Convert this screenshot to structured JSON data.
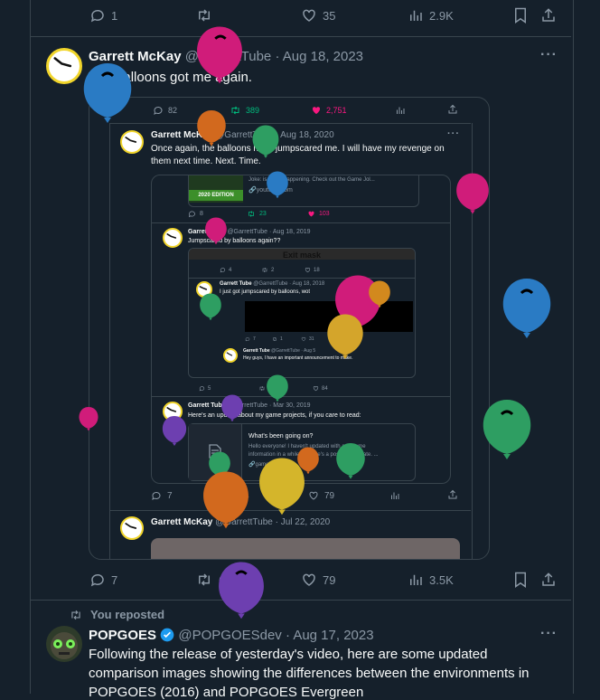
{
  "top_actions": {
    "replies": "1",
    "retweets": "",
    "likes": "35",
    "views": "2.9K"
  },
  "tweet1": {
    "name": "Garrett McKay",
    "handle": "@GarrettTube",
    "date": "· Aug 18, 2023",
    "text": "The balloons got me again.",
    "more": "···",
    "actions": {
      "replies": "7",
      "retweets": "6",
      "likes": "79",
      "views": "3.5K"
    }
  },
  "embed1": {
    "actions": {
      "replies": "82",
      "retweets": "389",
      "likes": "2,751"
    },
    "name": "Garrett McKay",
    "handle": "@GarrettTube",
    "date": "· Aug 18, 2020",
    "text1": "Once again, the balloons have jumpscared me. I will have my revenge on",
    "text2": "them next time. Next. Time.",
    "more": "···",
    "actions2": {
      "replies": "7",
      "retweets": "4",
      "likes": "79"
    },
    "next_name": "Garrett McKay",
    "next_handle": "@GarrettTube",
    "next_date": "· Jul 22, 2020"
  },
  "embed2": {
    "top_text": "Joke: is finally happening. Check out the Game Jol...",
    "top_link": "youtube.com",
    "game_label": "2020 EDITION",
    "actions": {
      "replies": "8",
      "retweets": "23",
      "likes": "103"
    },
    "name": "Garrett Tube",
    "handle": "@GarrettTube",
    "date": "· Aug 18, 2019",
    "text": "Jumpscared by balloons again??",
    "exit_label": "Exit mask",
    "actions_b": {
      "replies": "4",
      "retweets": "2",
      "likes": "18"
    },
    "a2": {
      "replies": "5",
      "retweets": "",
      "likes": "84"
    },
    "name3": "Garrett Tube",
    "handle3": "@GarrettTube",
    "date3": "· Mar 30, 2019",
    "text3": "Here's an update about my game projects, if you care to read:",
    "card_title": "What's been going on?",
    "card_text1": "Hello everyone! I haven't updated with any game",
    "card_text2": "information in a while, so here's a post to elaborate. ...",
    "card_link": "gamejolt.com"
  },
  "embed3": {
    "name": "Garrett Tube",
    "handle": "@GarrettTube",
    "date": "· Aug 18, 2018",
    "text": "I just got jumpscared by balloons, wot",
    "actions": {
      "replies": "7",
      "retweets": "1",
      "likes": "31"
    },
    "name4": "Garrett Tube",
    "handle4": "@GarrettTube",
    "date4": "· Aug 5",
    "text4": "Hey guys, I have an important announcement to make."
  },
  "repost": {
    "label": "You reposted"
  },
  "tweet2": {
    "name": "POPGOES",
    "handle": "@POPGOESdev",
    "date": "· Aug 17, 2023",
    "line1": "Following the release of yesterday's video, here are some updated",
    "line2": "comparison images showing the differences between the environments in",
    "line3": "POPGOES (2016) and POPGOES Evergreen",
    "more": "···"
  },
  "colors": {
    "bg": "#15202b",
    "border": "#38444d",
    "muted": "#8b98a5",
    "retweet": "#00ba7c",
    "like": "#f91880",
    "verified": "#1d9bf0"
  }
}
